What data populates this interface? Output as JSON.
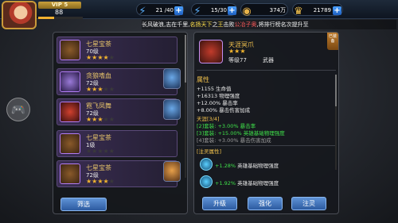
{
  "player": {
    "vip": "VIP 5",
    "level": "88"
  },
  "resources": [
    {
      "icon": "lightning-stamina-icon",
      "value": "21 /40"
    },
    {
      "icon": "lightning-energy-icon",
      "value": "15/30"
    },
    {
      "icon": "coin-icon",
      "value": "374万"
    },
    {
      "icon": "crown-gem-icon",
      "value": "21789"
    }
  ],
  "ticker": {
    "part1": "长风破浪,志在千里,",
    "part2": "名扬天下",
    "part3": "之",
    "part4": "王",
    "part5": "击败",
    "part6": "公冶子奥",
    "part7": ",将排行榜名次提升至"
  },
  "items": [
    {
      "name": "七星宝茶",
      "level": "70级",
      "stars": 4,
      "icon": "shield-item-icon",
      "hero": null
    },
    {
      "name": "贪狼嗜血",
      "level": "72级",
      "stars": 3,
      "icon": "claw-item-icon",
      "hero": "hero-portrait-icon"
    },
    {
      "name": "霓飞凤舞",
      "level": "72级",
      "stars": 3,
      "icon": "phoenix-item-icon",
      "hero": "hero-portrait-icon"
    },
    {
      "name": "七星宝茶",
      "level": "1级",
      "stars": 0,
      "icon": "shield-item-icon",
      "hero": null
    },
    {
      "name": "七星宝茶",
      "level": "72级",
      "stars": 4,
      "icon": "shield-item-icon",
      "hero": "hero-portrait-icon"
    }
  ],
  "filter_button": "筛选",
  "detail": {
    "name": "天涯冥爪",
    "stars": 3,
    "level": "等级77",
    "type": "武器",
    "equip_tag": "已装备",
    "attr_title": "属性",
    "attrs": [
      "+1155 生命值",
      "+16313 物理强度",
      "+12.00% 暴击率",
      "+8.00% 暴击伤害加成"
    ],
    "set_title": "天涯[3/4]",
    "set_bonus": [
      "[2]套装: +3.00% 暴击率",
      "[3]套装: +15.00% 英雄基础物理强度",
      "[4]套装: +3.00% 暴击伤害加成"
    ],
    "spirit_title": "[注灵属性]",
    "spirit": [
      {
        "value": "+1.28%",
        "text": " 英雄基础物理强度"
      },
      {
        "value": "+1.92%",
        "text": " 英雄基础物理强度"
      }
    ],
    "buttons": {
      "upgrade": "升级",
      "enhance": "强化",
      "infuse": "注灵"
    }
  }
}
